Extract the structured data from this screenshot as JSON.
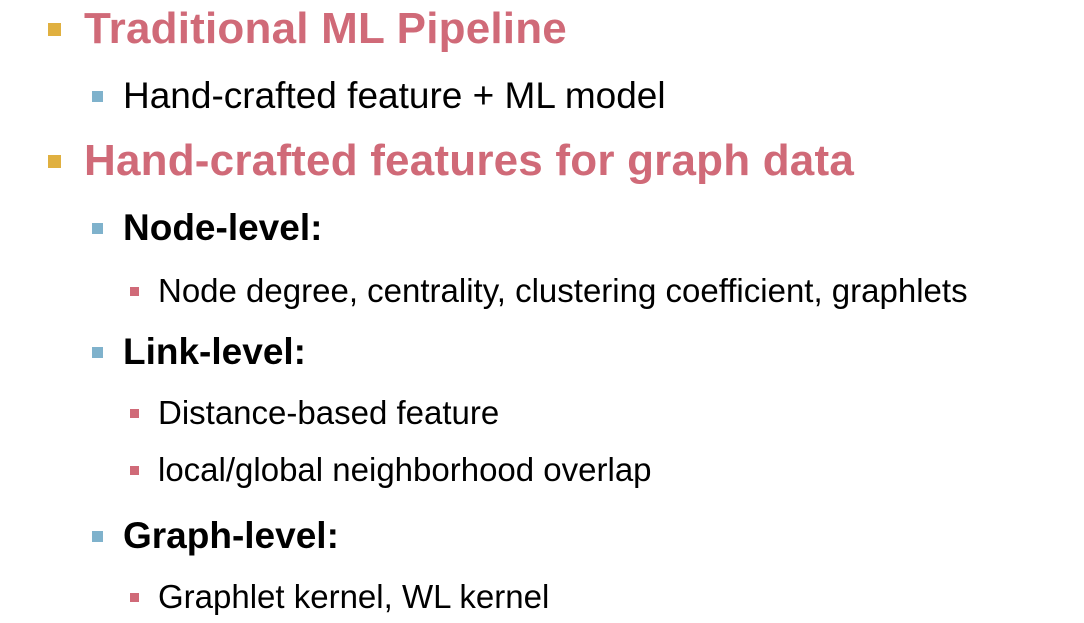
{
  "colors": {
    "heading": "#d06a78",
    "body_text": "#000000",
    "bullet_level1": "#e0b040",
    "bullet_level2": "#7fb2cc",
    "bullet_level3": "#d06a78"
  },
  "icons": {
    "level1": "square-bullet-icon",
    "level2": "square-bullet-icon",
    "level3": "square-bullet-icon"
  },
  "bullets": [
    {
      "level": 1,
      "text": "Traditional ML Pipeline"
    },
    {
      "level": 2,
      "text": "Hand-crafted feature + ML model"
    },
    {
      "level": 1,
      "text": "Hand-crafted features for graph data"
    },
    {
      "level": 2,
      "text": "Node-level:"
    },
    {
      "level": 3,
      "text": "Node degree, centrality, clustering coefficient, graphlets"
    },
    {
      "level": 2,
      "text": "Link-level:"
    },
    {
      "level": 3,
      "text": "Distance-based feature"
    },
    {
      "level": 3,
      "text": "local/global neighborhood overlap"
    },
    {
      "level": 2,
      "text": "Graph-level:"
    },
    {
      "level": 3,
      "text": "Graphlet kernel, WL kernel"
    }
  ]
}
